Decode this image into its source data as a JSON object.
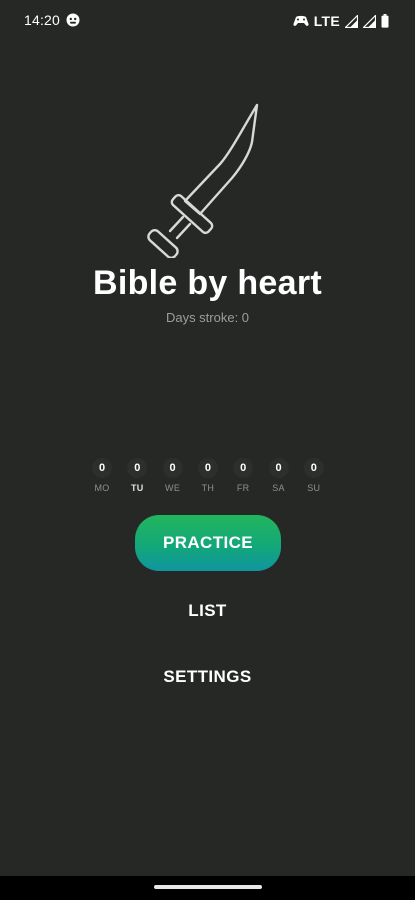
{
  "status_bar": {
    "time": "14:20",
    "network": "LTE",
    "icons": [
      "face-icon",
      "gamepad-icon",
      "signal-icon",
      "signal-icon",
      "battery-icon"
    ]
  },
  "app": {
    "logo_icon": "sword-icon",
    "title": "Bible by heart",
    "streak_label": "Days stroke: 0"
  },
  "days": [
    {
      "label": "MO",
      "count": "0",
      "today": false
    },
    {
      "label": "TU",
      "count": "0",
      "today": true
    },
    {
      "label": "WE",
      "count": "0",
      "today": false
    },
    {
      "label": "TH",
      "count": "0",
      "today": false
    },
    {
      "label": "FR",
      "count": "0",
      "today": false
    },
    {
      "label": "SA",
      "count": "0",
      "today": false
    },
    {
      "label": "SU",
      "count": "0",
      "today": false
    }
  ],
  "menu": {
    "practice_label": "PRACTICE",
    "list_label": "LIST",
    "settings_label": "SETTINGS"
  },
  "colors": {
    "background": "#262826",
    "accent_top": "#22b55e",
    "accent_bottom": "#0f95a0"
  }
}
